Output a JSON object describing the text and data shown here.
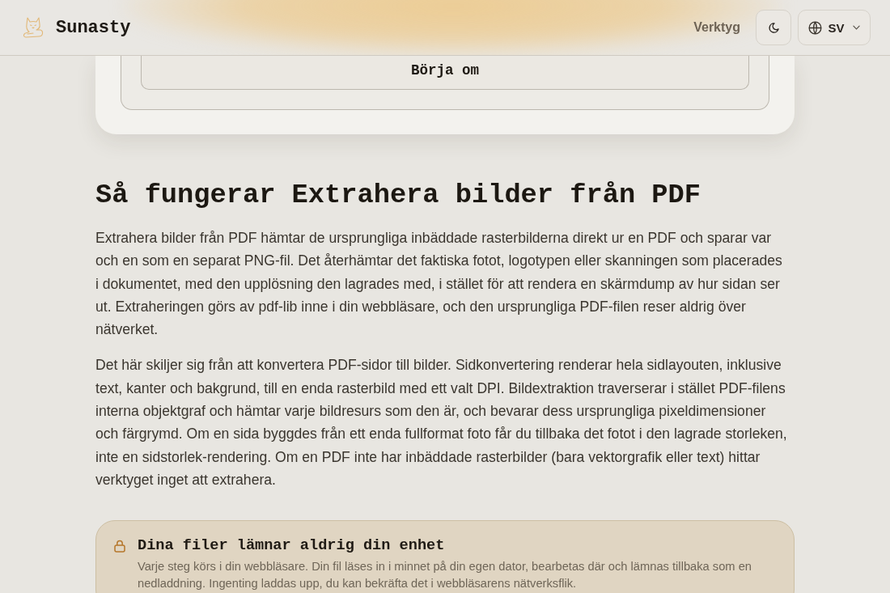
{
  "header": {
    "brand": "Sunasty",
    "nav": [
      {
        "label": "Verktyg"
      }
    ],
    "language": {
      "label": "SV"
    }
  },
  "tool_panel": {
    "button": "Börja om"
  },
  "article": {
    "heading": "Så fungerar Extrahera bilder från PDF",
    "paragraphs": [
      "Extrahera bilder från PDF hämtar de ursprungliga inbäddade rasterbilderna direkt ur en PDF och sparar var och en som en separat PNG-fil. Det återhämtar det faktiska fotot, logotypen eller skanningen som placerades i dokumentet, med den upplösning den lagrades med, i stället för att rendera en skärmdump av hur sidan ser ut. Extraheringen görs av pdf-lib inne i din webbläsare, och den ursprungliga PDF-filen reser aldrig över nätverket.",
      "Det här skiljer sig från att konvertera PDF-sidor till bilder. Sidkonvertering renderar hela sidlayouten, inklusive text, kanter och bakgrund, till en enda rasterbild med ett valt DPI. Bildextraktion traverserar i stället PDF-filens interna objektgraf och hämtar varje bildresurs som den är, och bevarar dess ursprungliga pixeldimensioner och färgrymd. Om en sida byggdes från ett enda fullformat foto får du tillbaka det fotot i den lagrade storleken, inte en sidstorlek-rendering. Om en PDF inte har inbäddade rasterbilder (bara vektorgrafik eller text) hittar verktyget inget att extrahera."
    ]
  },
  "privacy_note": {
    "title": "Dina filer lämnar aldrig din enhet",
    "text": "Varje steg körs i din webbläsare. Din fil läses in i minnet på din egen dator, bearbetas där och lämnas tillbaka som en nedladdning. Ingenting laddas upp, du kan bekräfta det i webbläsarens nätverksflik."
  }
}
